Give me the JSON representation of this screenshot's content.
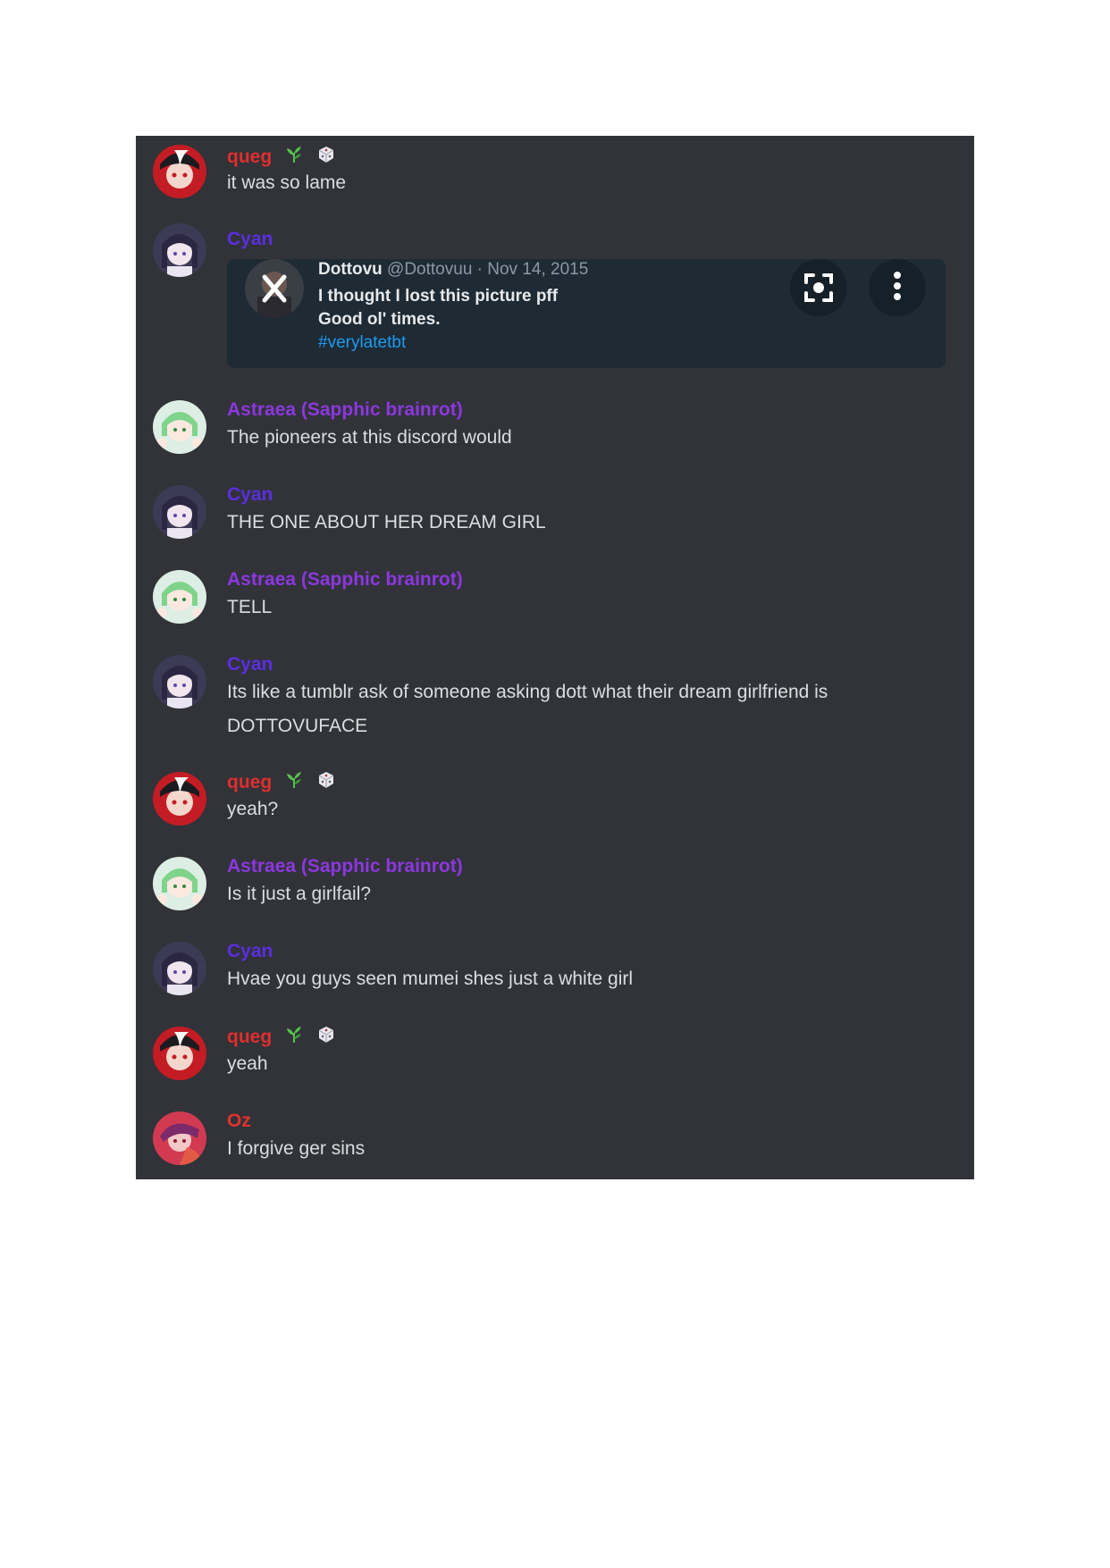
{
  "colors": {
    "queg": "#e02e2e",
    "cyan": "#5b2ee0",
    "astraea": "#8c37e0",
    "oz": "#e0322e",
    "message_text": "#dbdee1",
    "chat_bg": "#313338"
  },
  "messages": [
    {
      "author": "queg",
      "badges": [
        "leaf-icon",
        "dice-icon"
      ],
      "lines": [
        "it was so lame"
      ]
    },
    {
      "author": "Cyan",
      "badges": [],
      "lines": []
    },
    {
      "author": "Astraea (Sapphic brainrot)",
      "badges": [],
      "lines": [
        "The pioneers at this discord would"
      ]
    },
    {
      "author": "Cyan",
      "badges": [],
      "lines": [
        "THE ONE ABOUT HER DREAM GIRL"
      ]
    },
    {
      "author": "Astraea (Sapphic brainrot)",
      "badges": [],
      "lines": [
        "TELL"
      ]
    },
    {
      "author": "Cyan",
      "badges": [],
      "lines": [
        "Its like a tumblr ask of someone asking dott what their dream girlfriend is",
        "DOTTOVUFACE"
      ]
    },
    {
      "author": "queg",
      "badges": [
        "leaf-icon",
        "dice-icon"
      ],
      "lines": [
        "yeah?"
      ]
    },
    {
      "author": "Astraea (Sapphic brainrot)",
      "badges": [],
      "lines": [
        "Is it just a girlfail?"
      ]
    },
    {
      "author": "Cyan",
      "badges": [],
      "lines": [
        "Hvae you guys seen mumei shes just a white girl"
      ]
    },
    {
      "author": "queg",
      "badges": [
        "leaf-icon",
        "dice-icon"
      ],
      "lines": [
        "yeah"
      ]
    },
    {
      "author": "Oz",
      "badges": [],
      "lines": [
        "I forgive ger sins"
      ]
    }
  ],
  "embed": {
    "name": "Dottovu",
    "handle": "@Dottovuu · Nov 14, 2015",
    "line1": "I thought I lost this picture pff",
    "line2": "Good ol' times.",
    "hashtag": "#verylatetbt",
    "close_icon": "close-icon",
    "lens_icon": "lens-icon",
    "more_icon": "more-vertical-icon"
  }
}
